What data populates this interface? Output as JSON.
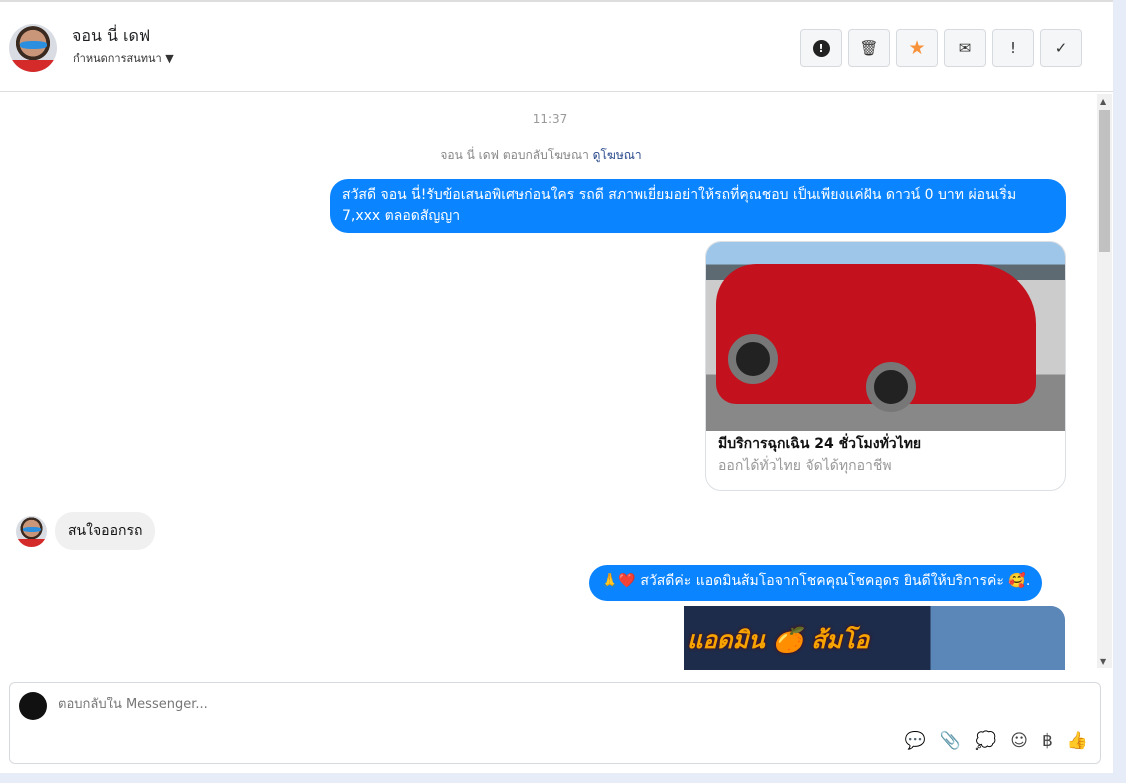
{
  "header": {
    "name": "จอน นี่ เดฟ",
    "subtitle": "กำหนดการสนทนา",
    "tools": [
      "!",
      "🗑",
      "★",
      "✉",
      "!",
      "✓"
    ]
  },
  "conversation": {
    "timestamp": "11:37",
    "reply_note": "จอน นี่ เดฟ ตอบกลับโฆษณา",
    "reply_link": "ดูโฆษณา",
    "msg1": "สวัสดี จอน นี่!รับข้อเสนอพิเศษก่อนใคร รถดี สภาพเยี่ยมอย่าให้รถที่คุณชอบ เป็นเพียงแค่ฝัน ดาวน์ 0 บาท ผ่อนเริ่ม 7,xxx ตลอดสัญญา",
    "card_title": "มีบริการฉุกเฉิน 24 ชั่วโมงทั่วไทย",
    "card_subtitle": "ออกได้ทั่วไทย จัดได้ทุกอาชีพ",
    "incoming": "สนใจออกรถ",
    "msg2": "🙏❤️ สวัสดีค่ะ แอดมินส้มโอจากโชคคุณโชคอุดร ยินดีให้บริการค่ะ 🥰.",
    "banner_text": "แอดมิน 🍊 ส้มโอ"
  },
  "composer": {
    "placeholder": "ตอบกลับใน Messenger...",
    "icons": [
      "💬",
      "📎",
      "💭",
      "☺",
      "฿",
      "👍"
    ]
  }
}
